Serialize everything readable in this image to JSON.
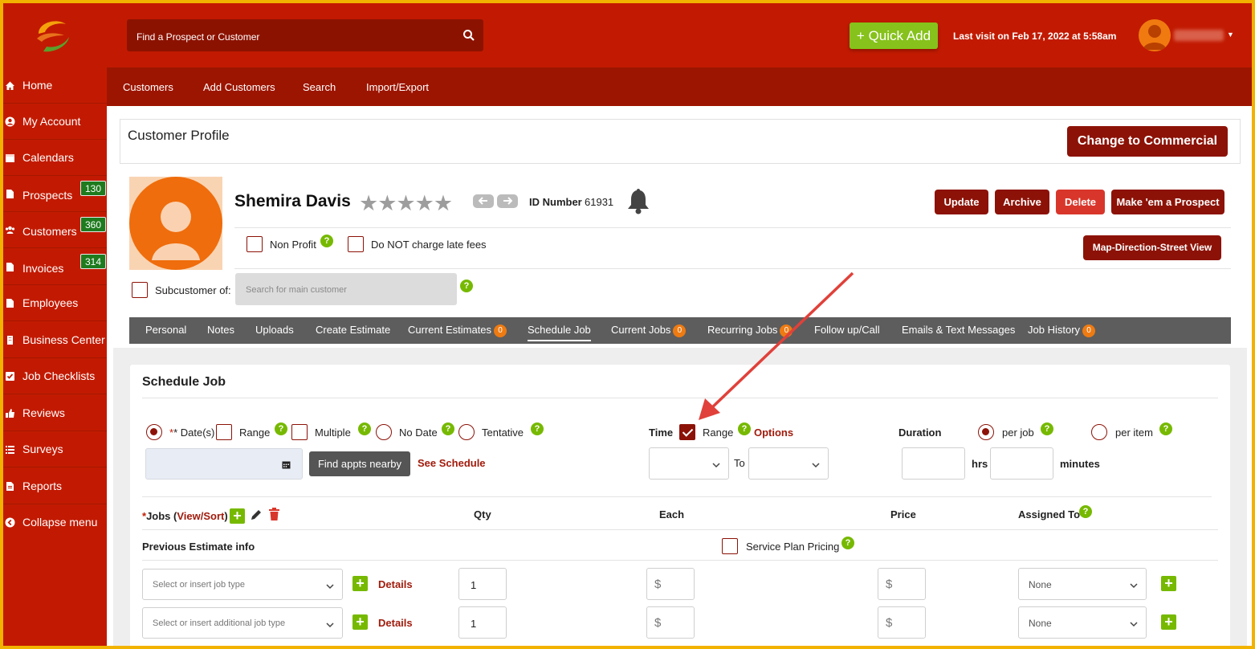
{
  "header": {
    "search_placeholder": "Find a Prospect or Customer",
    "quick_add": "+ Quick Add",
    "last_visit": "Last visit on  Feb 17, 2022  at 5:58am"
  },
  "sidebar": {
    "items": [
      {
        "label": "Home",
        "icon": "home-icon"
      },
      {
        "label": "My Account",
        "icon": "user-circle-icon"
      },
      {
        "label": "Calendars",
        "icon": "calendar-icon"
      },
      {
        "label": "Prospects",
        "icon": "document-icon",
        "badge": "130"
      },
      {
        "label": "Customers",
        "icon": "users-icon",
        "badge": "360"
      },
      {
        "label": "Invoices",
        "icon": "document-icon",
        "badge": "314"
      },
      {
        "label": "Employees",
        "icon": "document-icon"
      },
      {
        "label": "Business Center",
        "icon": "building-icon"
      },
      {
        "label": "Job Checklists",
        "icon": "checkbox-icon"
      },
      {
        "label": "Reviews",
        "icon": "thumbs-up-icon"
      },
      {
        "label": "Surveys",
        "icon": "list-icon"
      },
      {
        "label": "Reports",
        "icon": "report-icon"
      },
      {
        "label": "Collapse menu",
        "icon": "chevron-left-circle-icon"
      }
    ]
  },
  "subnav": [
    "Customers",
    "Add Customers",
    "Search",
    "Import/Export"
  ],
  "profile": {
    "title": "Customer Profile",
    "change_commercial": "Change to Commercial",
    "name": "Shemira Davis",
    "stars": "★★★★★",
    "id_label": "ID Number",
    "id_value": "61931",
    "buttons": {
      "update": "Update",
      "archive": "Archive",
      "delete": "Delete",
      "prospect": "Make 'em a Prospect",
      "map": "Map-Direction-Street View"
    },
    "non_profit": "Non Profit",
    "no_late_fees": "Do NOT charge late fees",
    "subcustomer": "Subcustomer of:",
    "subcustomer_placeholder": "Search for main customer"
  },
  "tabs": [
    {
      "label": "Personal"
    },
    {
      "label": "Notes"
    },
    {
      "label": "Uploads"
    },
    {
      "label": "Create Estimate"
    },
    {
      "label": "Current Estimates",
      "badge": "0"
    },
    {
      "label": "Schedule Job"
    },
    {
      "label": "Current Jobs",
      "badge": "0"
    },
    {
      "label": "Recurring Jobs",
      "badge": "0"
    },
    {
      "label": "Follow up/Call"
    },
    {
      "label": "Emails & Text Messages"
    },
    {
      "label": "Job History",
      "badge": "0"
    }
  ],
  "schedule": {
    "title": "Schedule Job",
    "dates_label": "* Date(s)",
    "range": "Range",
    "multiple": "Multiple",
    "no_date": "No Date",
    "tentative": "Tentative",
    "find_btn": "Find appts nearby",
    "see_schedule": "See Schedule",
    "time": "Time",
    "time_range": "Range",
    "options": "Options",
    "to": "To",
    "duration": "Duration",
    "per_job": "per job",
    "per_item": "per item",
    "hrs": "hrs",
    "minutes": "minutes",
    "jobs_star": "*",
    "jobs_label": "Jobs (",
    "view_sort": "View/Sort",
    "jobs_close": ")",
    "qty": "Qty",
    "each": "Each",
    "price": "Price",
    "assigned_to": "Assigned To",
    "prev_estimate": "Previous Estimate info",
    "service_plan": "Service Plan Pricing",
    "rows": [
      {
        "job_placeholder": "Select or insert job type",
        "details": "Details",
        "qty": "1",
        "each": "$",
        "price": "$",
        "assigned": "None"
      },
      {
        "job_placeholder": "Select or insert additional job type",
        "details": "Details",
        "qty": "1",
        "each": "$",
        "price": "$",
        "assigned": "None"
      }
    ]
  },
  "colors": {
    "brand_red": "#c21a02",
    "dark_red": "#8c1207",
    "green": "#76b900",
    "border_gold": "#f2b200"
  }
}
